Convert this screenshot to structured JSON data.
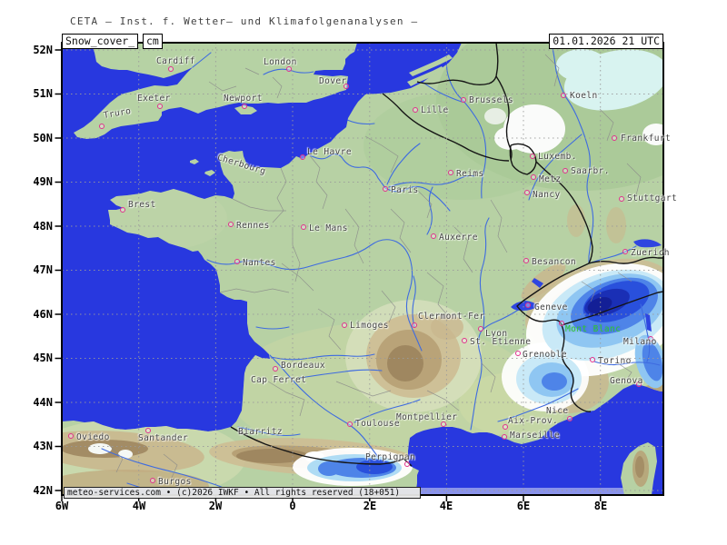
{
  "header": {
    "title": "CETA — Inst. f. Wetter— und Klimafolgenanalysen —",
    "layer": "Snow_cover_",
    "unit": "cm",
    "datetime": "01.01.2026  21  UTC"
  },
  "axes": {
    "lat": [
      "52N",
      "51N",
      "50N",
      "49N",
      "48N",
      "47N",
      "46N",
      "45N",
      "44N",
      "43N",
      "42N"
    ],
    "lon": [
      "6W",
      "4W",
      "2W",
      "0",
      "2E",
      "4E",
      "6E",
      "8E"
    ]
  },
  "cities": [
    {
      "name": "Cardiff"
    },
    {
      "name": "London"
    },
    {
      "name": "Dover"
    },
    {
      "name": "Exeter"
    },
    {
      "name": "Newport"
    },
    {
      "name": "Truro"
    },
    {
      "name": "Lille"
    },
    {
      "name": "Brussels"
    },
    {
      "name": "Koeln"
    },
    {
      "name": "Frankfurt"
    },
    {
      "name": "Luxemb."
    },
    {
      "name": "Metz"
    },
    {
      "name": "Saarbr."
    },
    {
      "name": "Nancy"
    },
    {
      "name": "Reims"
    },
    {
      "name": "Paris"
    },
    {
      "name": "Le Havre"
    },
    {
      "name": "Cherbourg"
    },
    {
      "name": "Brest"
    },
    {
      "name": "Rennes"
    },
    {
      "name": "Le Mans"
    },
    {
      "name": "Nantes"
    },
    {
      "name": "Auxerre"
    },
    {
      "name": "Besancon"
    },
    {
      "name": "Zuerich"
    },
    {
      "name": "Geneve"
    },
    {
      "name": "Mont Blanc",
      "type": "peak"
    },
    {
      "name": "Milano"
    },
    {
      "name": "Torino"
    },
    {
      "name": "Genova"
    },
    {
      "name": "Clermont-Fer"
    },
    {
      "name": "Lyon"
    },
    {
      "name": "St. Etienne"
    },
    {
      "name": "Grenoble"
    },
    {
      "name": "Limoges"
    },
    {
      "name": "Bordeaux"
    },
    {
      "name": "Cap Ferret"
    },
    {
      "name": "Biarritz"
    },
    {
      "name": "Toulouse"
    },
    {
      "name": "Montpellier"
    },
    {
      "name": "Aix-Prov."
    },
    {
      "name": "Marseille"
    },
    {
      "name": "Nice"
    },
    {
      "name": "Perpignan"
    },
    {
      "name": "Oviedo"
    },
    {
      "name": "Santander"
    },
    {
      "name": "Burgos"
    },
    {
      "name": "Stuttgart"
    }
  ],
  "footer": {
    "text": "meteo-services.com • (c)2026 IWKF • All rights reserved (18+051)"
  },
  "colors": {
    "sea": "#2838DF",
    "sea_strip": "#8A93EA",
    "land": "#B7D1A4",
    "land_north": "#A3C58F",
    "snow_trace_cyan": "#D8F3F0",
    "snow_white": "#FAFBFA",
    "snow_light": "#8FC6F2",
    "snow_mid": "#4E84E8",
    "snow_deep": "#2950DC",
    "snow_max": "#1A2FB5",
    "terrain_low": "#CDBC94",
    "terrain_mid": "#B7A176",
    "terrain_high": "#9F8760",
    "river": "#3E6BE0",
    "border": "#151515",
    "admin": "#8A8A8A",
    "grid": "#9B9B9B",
    "city_marker": "#E0308C",
    "peak_label": "#2FCC2F",
    "label_text": "#444444"
  }
}
